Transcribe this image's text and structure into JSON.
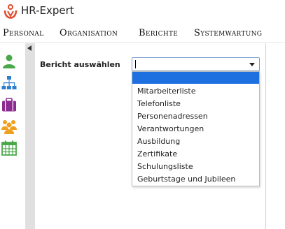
{
  "app": {
    "title": "HR-Expert",
    "logo_icon": "hr-expert-logo"
  },
  "menu": [
    "Personal",
    "Organisation",
    "Berichte",
    "Systemwartung"
  ],
  "sidebar": {
    "icons": [
      {
        "name": "person-icon",
        "color": "#4aa84a"
      },
      {
        "name": "org-chart-icon",
        "color": "#2f7fd0"
      },
      {
        "name": "briefcase-icon",
        "color": "#8b2b8f"
      },
      {
        "name": "group-icon",
        "color": "#f0a020"
      },
      {
        "name": "calendar-icon",
        "color": "#4aa84a"
      }
    ]
  },
  "report": {
    "label": "Bericht auswählen",
    "value": "",
    "options": [
      "",
      "Mitarbeiterliste",
      "Telefonliste",
      "Personenadressen",
      "Verantwortungen",
      "Ausbildung",
      "Zertifikate",
      "Schulungsliste",
      "Geburtstage und Jubileen"
    ],
    "highlight_color": "#1e6fe0"
  }
}
